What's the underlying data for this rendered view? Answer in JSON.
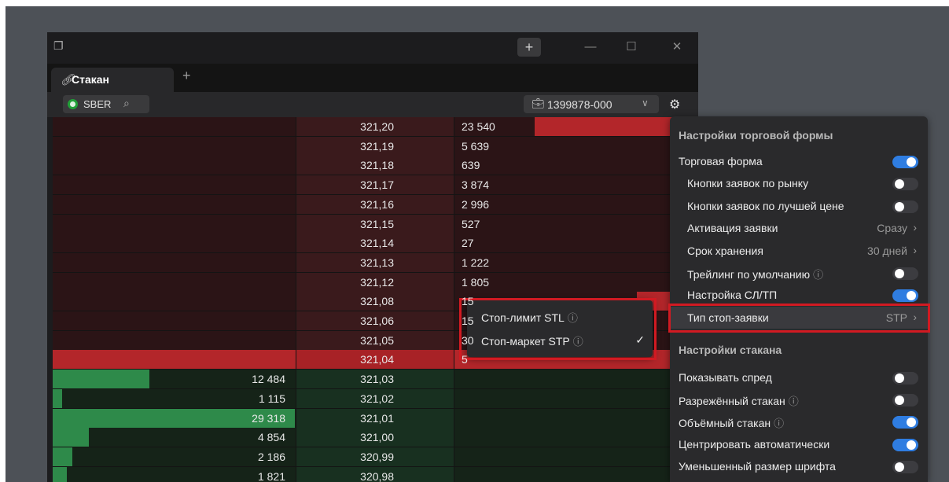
{
  "window": {
    "tab_label": "Стакан",
    "toolbar": {
      "ticker": "SBER",
      "account": "1399878-000"
    }
  },
  "book": {
    "asks": [
      {
        "price": "321,20",
        "volume": "23 540",
        "fill": 0.67
      },
      {
        "price": "321,19",
        "volume": "5 639",
        "fill": 0.1
      },
      {
        "price": "321,18",
        "volume": "639",
        "fill": 0.02
      },
      {
        "price": "321,17",
        "volume": "3 874",
        "fill": 0.05
      },
      {
        "price": "321,16",
        "volume": "2 996",
        "fill": 0.04
      },
      {
        "price": "321,15",
        "volume": "527",
        "fill": 0.01
      },
      {
        "price": "321,14",
        "volume": "27",
        "fill": 0.0
      },
      {
        "price": "321,13",
        "volume": "1 222",
        "fill": 0.02
      },
      {
        "price": "321,12",
        "volume": "1 805",
        "fill": 0.02
      },
      {
        "price": "321,08",
        "volume": "15",
        "fill": 0.25
      },
      {
        "price": "321,06",
        "volume": "15",
        "fill": 0.03
      },
      {
        "price": "321,05",
        "volume": "30",
        "fill": 0.03
      }
    ],
    "best_ask": {
      "price": "321,04",
      "volume": "5"
    },
    "bids": [
      {
        "price": "321,03",
        "volume": "12 484",
        "fill": 0.4
      },
      {
        "price": "321,02",
        "volume": "1 115",
        "fill": 0.04
      },
      {
        "price": "321,01",
        "volume": "29 318",
        "fill": 1.0
      },
      {
        "price": "321,00",
        "volume": "4 854",
        "fill": 0.15
      },
      {
        "price": "320,99",
        "volume": "2 186",
        "fill": 0.08
      },
      {
        "price": "320,98",
        "volume": "1 821",
        "fill": 0.06
      }
    ]
  },
  "settings": {
    "trade_form_header": "Настройки торговой формы",
    "trade_form": "Торговая форма",
    "market_buttons": "Кнопки заявок по рынку",
    "best_price_buttons": "Кнопки заявок по лучшей цене",
    "activation": "Активация заявки",
    "activation_value": "Сразу",
    "expiry": "Срок хранения",
    "expiry_value": "30 дней",
    "trailing": "Трейлинг по умолчанию",
    "sltp": "Настройка СЛ/ТП",
    "stop_type": "Тип стоп-заявки",
    "stop_type_value": "STP",
    "book_header": "Настройки стакана",
    "show_spread": "Показывать спред",
    "sparse_book": "Разрежённый стакан",
    "volume_book": "Объёмный стакан",
    "auto_center": "Центрировать автоматически",
    "small_font": "Уменьшенный размер шрифта",
    "toggles": {
      "trade_form": true,
      "market_buttons": false,
      "best_price_buttons": false,
      "trailing": false,
      "sltp": true,
      "show_spread": false,
      "sparse_book": false,
      "volume_book": true,
      "auto_center": true,
      "small_font": false
    }
  },
  "stop_popup": {
    "stl": "Стоп-лимит STL",
    "stp": "Стоп-маркет STP",
    "selected": "stp"
  },
  "colors": {
    "ask_bar": "#b3262a",
    "bid_bar": "#2e8a4a",
    "accent": "#2f7de1",
    "highlight_box": "#d11a22"
  }
}
